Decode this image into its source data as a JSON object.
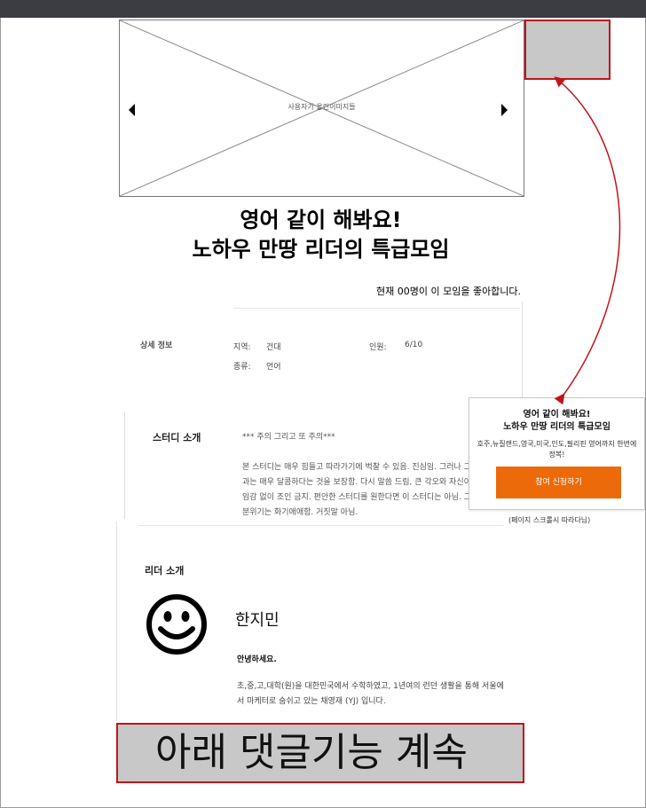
{
  "carousel": {
    "caption": "사용자가 올린이미지들"
  },
  "title": {
    "line1": "영어 같이 해봐요!",
    "line2": "노하우 만땅 리더의 특급모임"
  },
  "likes": "현재 00명이 이 모임을 좋아합니다.",
  "detail": {
    "section_label": "상세 정보",
    "region_label": "지역:",
    "region_value": "건대",
    "members_label": "인원:",
    "members_value": "6/10",
    "type_label": "종류:",
    "type_value": "언어"
  },
  "study": {
    "label": "스터디 소개",
    "lines": [
      "*** 주의 그리고 또 주의***",
      "",
      "본 스터디는 매우 힘들고 따라가기에 벅찰 수 있음. 진심임. 그러나 그",
      "과는 매우 달콤하다는 것을 보장함. 다시 말씀 드림, 큰 각오와 자신이",
      "임감 없이 조인 금지. 편안한 스터디를 원한다면 이 스터디는 아님. 그",
      "분위기는 화기애애함. 거짓말 아님."
    ]
  },
  "leader": {
    "label": "리더 소개",
    "name": "한지민",
    "greeting": "안녕하세요.",
    "intro": "초,중,고,대학(원)을 대한민국에서 수학하였고, 1년여의 런던 생활을 통해 서울에서 마케터로 숨쉬고 있는 채영재 (YJ) 입니다."
  },
  "floating": {
    "title_line1": "영어 같이 해봐요!",
    "title_line2": "노하우 만땅 리더의 특급모임",
    "desc": "호주,뉴질랜드,영국,미국,인도,필리핀 영어까지 한번에 정복!",
    "join_button": "참여 신청하기",
    "note": "(페이지 스크롤시 따라다님)"
  },
  "comment_note": "아래 댓글기능 계속",
  "colors": {
    "accent_orange": "#ec6a0a",
    "annotation_red": "#c0141b",
    "placeholder_gray": "#c8c8c8",
    "topbar": "#3b3d42"
  },
  "icons": {
    "prev": "triangle-left-icon",
    "next": "triangle-right-icon",
    "avatar": "smiley-face-icon"
  }
}
